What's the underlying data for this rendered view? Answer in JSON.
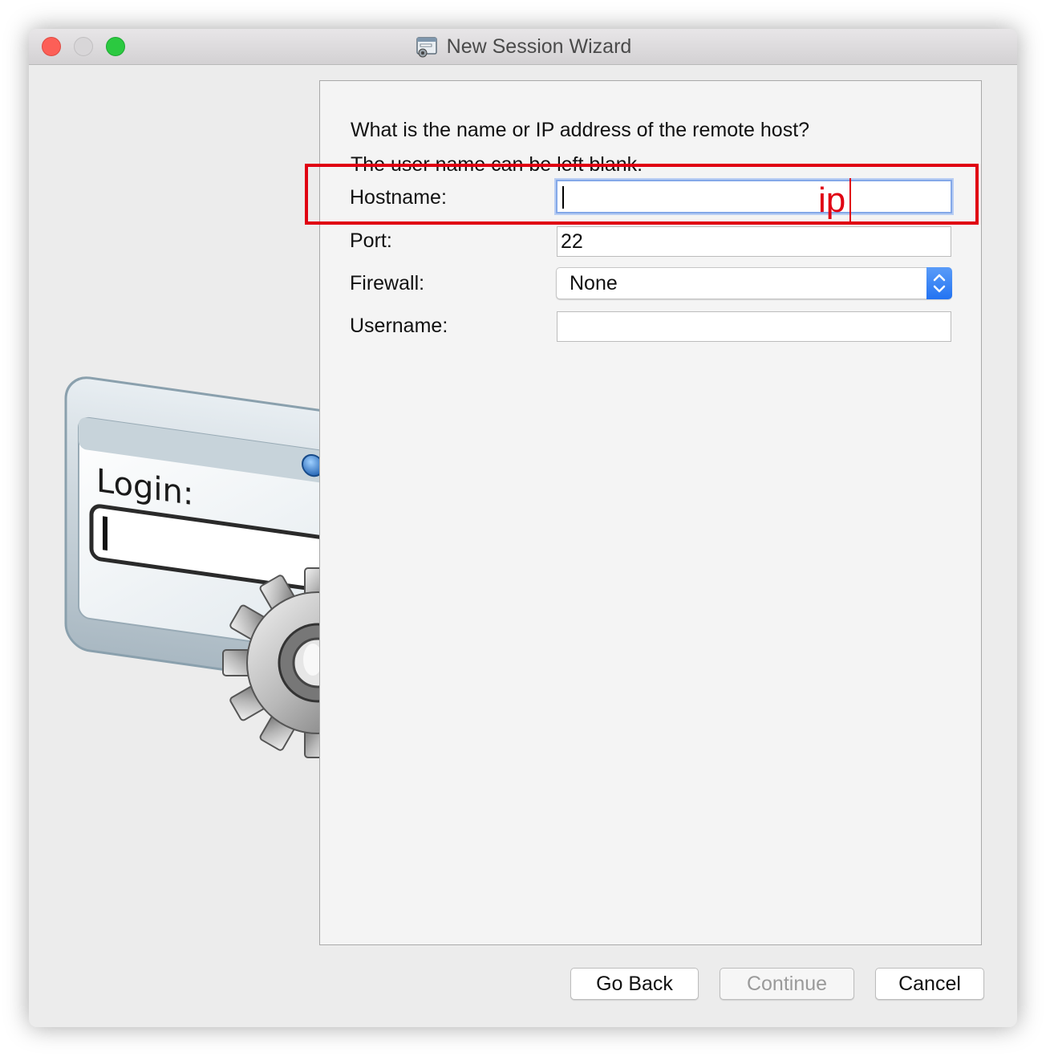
{
  "window": {
    "title": "New Session Wizard"
  },
  "form": {
    "question_line1": "What is the name or IP address of the remote host?",
    "question_line2": "The user name can be left blank.",
    "hostname_label": "Hostname:",
    "hostname_value": "",
    "port_label": "Port:",
    "port_value": "22",
    "firewall_label": "Firewall:",
    "firewall_value": "None",
    "username_label": "Username:",
    "username_value": ""
  },
  "illustration": {
    "login_label": "Login:"
  },
  "annotation": {
    "text": "ip",
    "color": "#e00012"
  },
  "buttons": {
    "go_back": "Go Back",
    "continue": "Continue",
    "cancel": "Cancel"
  }
}
